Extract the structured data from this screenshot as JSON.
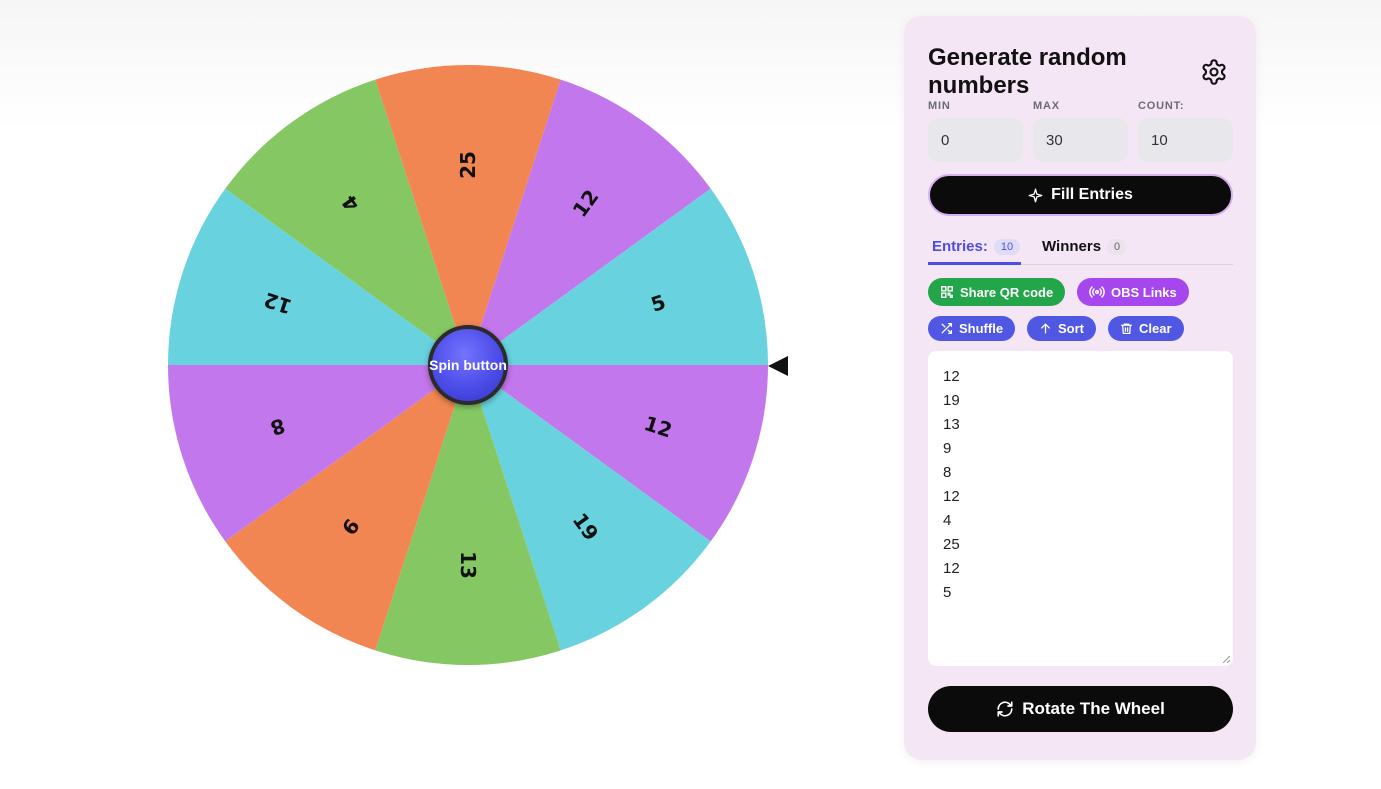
{
  "wheel": {
    "spin_label": "Spin button",
    "segments": [
      {
        "label": "12",
        "color": "#c377ec"
      },
      {
        "label": "19",
        "color": "#68d3df"
      },
      {
        "label": "13",
        "color": "#85c863"
      },
      {
        "label": "9",
        "color": "#f28652"
      },
      {
        "label": "8",
        "color": "#c377ec"
      },
      {
        "label": "12",
        "color": "#68d3df"
      },
      {
        "label": "4",
        "color": "#85c863"
      },
      {
        "label": "25",
        "color": "#f28652"
      },
      {
        "label": "12",
        "color": "#c377ec"
      },
      {
        "label": "5",
        "color": "#68d3df"
      }
    ]
  },
  "panel": {
    "title": "Generate random numbers",
    "settings_icon": "gear-icon",
    "min_label": "MIN",
    "min_value": "0",
    "max_label": "MAX",
    "max_value": "30",
    "count_label": "COUNT:",
    "count_value": "10",
    "fill_label": "Fill Entries",
    "tabs": {
      "entries_label": "Entries:",
      "entries_count": "10",
      "winners_label": "Winners",
      "winners_count": "0"
    },
    "actions": {
      "share_qr": "Share QR code",
      "obs_links": "OBS Links",
      "shuffle": "Shuffle",
      "sort": "Sort",
      "clear": "Clear"
    },
    "entries": [
      "12",
      "19",
      "13",
      "9",
      "8",
      "12",
      "4",
      "25",
      "12",
      "5"
    ],
    "rotate_label": "Rotate The Wheel"
  }
}
